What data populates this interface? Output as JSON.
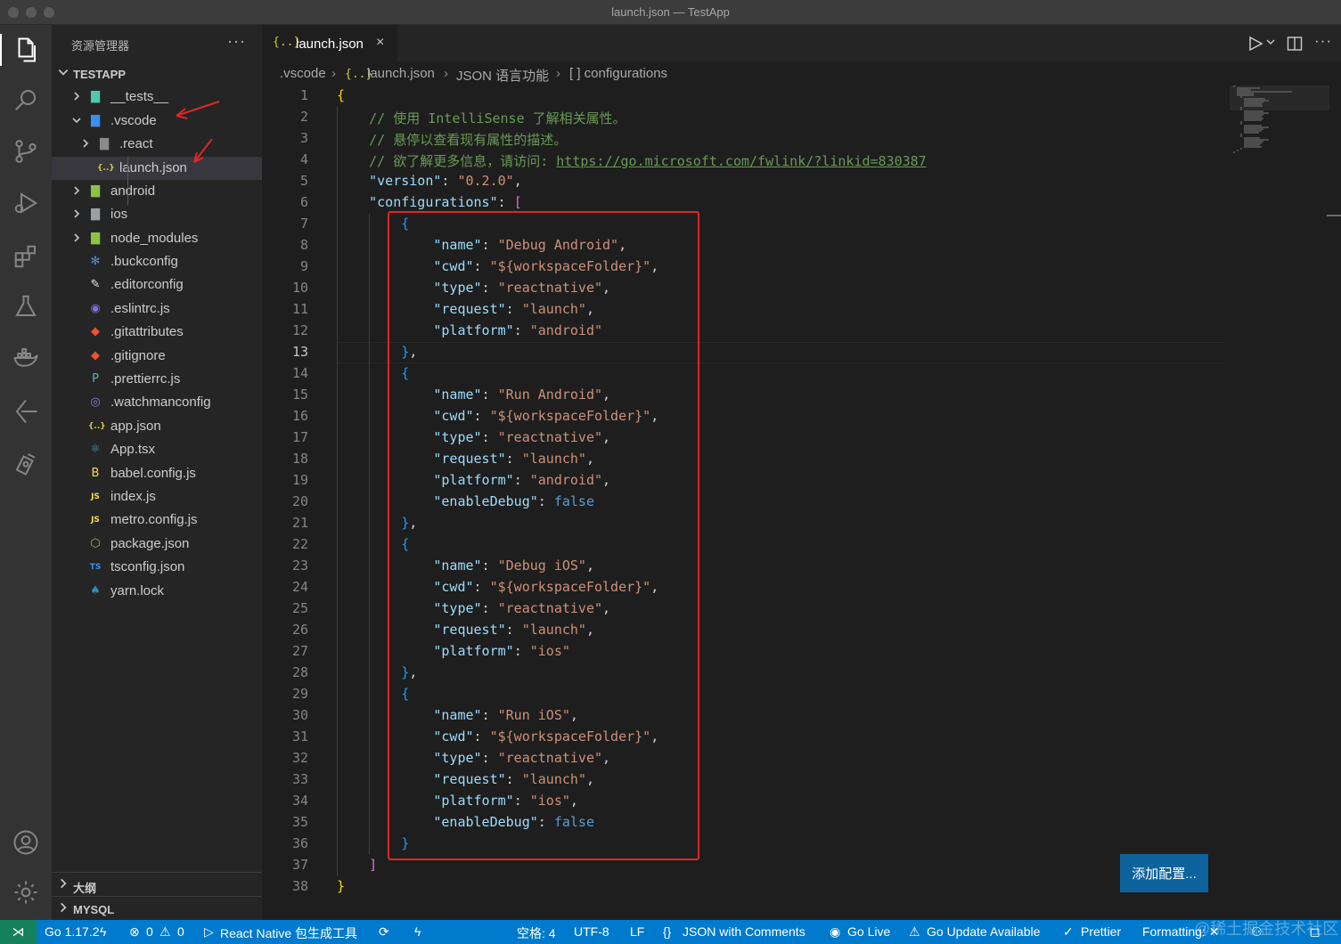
{
  "window": {
    "title": "launch.json — TestApp"
  },
  "activity_bar": {
    "items": [
      "explorer-icon",
      "search-icon",
      "source-control-icon",
      "run-debug-icon",
      "extensions-icon",
      "testing-icon",
      "docker-icon",
      "gitlens-icon",
      "remote-icon"
    ],
    "bottom": [
      "account-icon",
      "settings-gear-icon"
    ]
  },
  "sidebar": {
    "title": "资源管理器",
    "more": "···",
    "project": "TESTAPP",
    "files": [
      {
        "name": "__tests__",
        "icon": "▇",
        "color": "#4ec9b0"
      },
      {
        "name": ".vscode",
        "icon": "▇",
        "color": "#3b8eea"
      },
      {
        "name": ".react",
        "icon": "▇",
        "color": "#8a8a8a"
      },
      {
        "name": "launch.json",
        "icon": "{..}",
        "color": "#cbcb41"
      },
      {
        "name": "android",
        "icon": "▇",
        "color": "#8bc34a"
      },
      {
        "name": "ios",
        "icon": "▇",
        "color": "#9aa0a6"
      },
      {
        "name": "node_modules",
        "icon": "▇",
        "color": "#8bc34a"
      },
      {
        "name": ".buckconfig",
        "icon": "✻",
        "color": "#4a90d9"
      },
      {
        "name": ".editorconfig",
        "icon": "✎",
        "color": "#e8e8e8"
      },
      {
        "name": ".eslintrc.js",
        "icon": "◉",
        "color": "#7c6fe0"
      },
      {
        "name": ".gitattributes",
        "icon": "◆",
        "color": "#f05033"
      },
      {
        "name": ".gitignore",
        "icon": "◆",
        "color": "#f05033"
      },
      {
        "name": ".prettierrc.js",
        "icon": "P",
        "color": "#56b3b4"
      },
      {
        "name": ".watchmanconfig",
        "icon": "◎",
        "color": "#8b7de8"
      },
      {
        "name": "app.json",
        "icon": "{..}",
        "color": "#cbcb41"
      },
      {
        "name": "App.tsx",
        "icon": "⚛",
        "color": "#519aba"
      },
      {
        "name": "babel.config.js",
        "icon": "B",
        "color": "#f5da55"
      },
      {
        "name": "index.js",
        "icon": "JS",
        "color": "#f5da55"
      },
      {
        "name": "metro.config.js",
        "icon": "JS",
        "color": "#f5da55"
      },
      {
        "name": "package.json",
        "icon": "⬡",
        "color": "#8bc34a"
      },
      {
        "name": "tsconfig.json",
        "icon": "TS",
        "color": "#3b8eea"
      },
      {
        "name": "yarn.lock",
        "icon": "♠",
        "color": "#2c8ebb"
      }
    ],
    "outline": "大纲",
    "mysql": "MYSQL"
  },
  "editor": {
    "tab_label": "launch.json",
    "tab_icon": "{..}",
    "tab_close": "×",
    "breadcrumb": [
      ".vscode",
      "launch.json",
      "JSON 语言功能",
      "[ ] configurations"
    ],
    "current_line": 13,
    "add_config_button": "添加配置..."
  },
  "code": {
    "comment1": "// 使用 IntelliSense 了解相关属性。",
    "comment2": "// 悬停以查看现有属性的描述。",
    "comment3": "// 欲了解更多信息，请访问: ",
    "link": "https://go.microsoft.com/fwlink/?linkid=830387",
    "version": "0.2.0",
    "workspace": "${workspaceFolder}",
    "type": "reactnative",
    "request": "launch",
    "configs": [
      {
        "name": "Debug Android",
        "platform": "android",
        "enableDebug": null
      },
      {
        "name": "Run Android",
        "platform": "android",
        "enableDebug": "false"
      },
      {
        "name": "Debug iOS",
        "platform": "ios",
        "enableDebug": null
      },
      {
        "name": "Run iOS",
        "platform": "ios",
        "enableDebug": "false"
      }
    ]
  },
  "status_bar": {
    "go_version": "Go 1.17.2",
    "errors": "0",
    "warnings": "0",
    "react_native": "React Native 包生成工具",
    "spaces": "空格: 4",
    "encoding": "UTF-8",
    "eol": "LF",
    "language": "JSON with Comments",
    "go_live": "Go Live",
    "go_update": "Go Update Available",
    "prettier": "Prettier",
    "formatting": "Formatting: ✕"
  },
  "watermark": "@稀土掘金技术社区",
  "colors": {
    "accent": "#007acc",
    "button": "#0e639c",
    "annotation": "#e02626"
  }
}
